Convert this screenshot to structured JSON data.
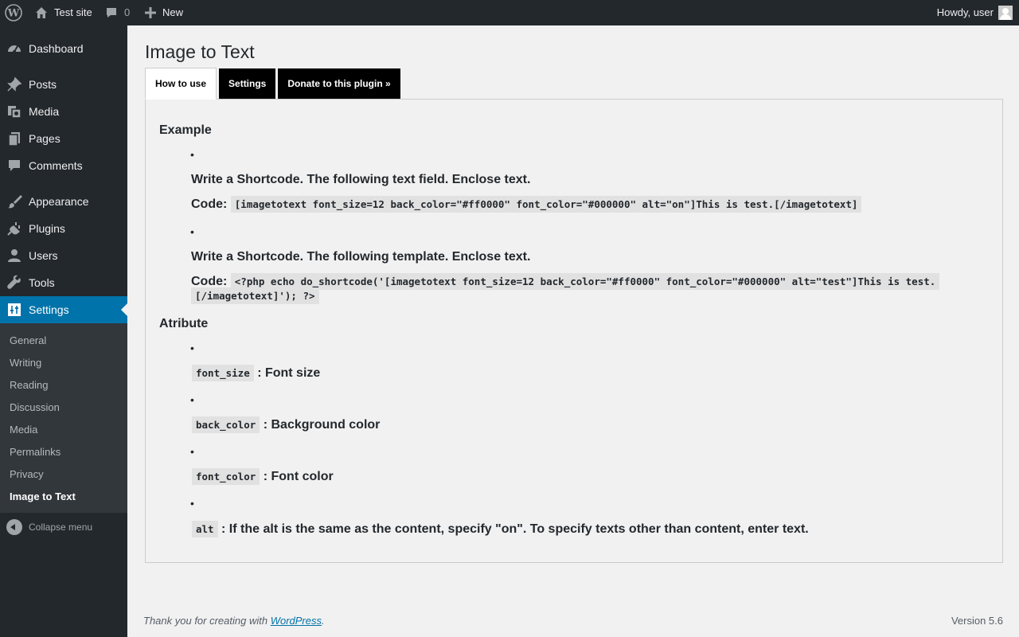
{
  "adminbar": {
    "site_name": "Test site",
    "comments_count": "0",
    "new_label": "New",
    "howdy": "Howdy, user"
  },
  "menu": {
    "items": [
      {
        "label": "Dashboard",
        "icon": "dashboard-icon"
      },
      {
        "label": "Posts",
        "icon": "pin-icon"
      },
      {
        "label": "Media",
        "icon": "media-icon"
      },
      {
        "label": "Pages",
        "icon": "pages-icon"
      },
      {
        "label": "Comments",
        "icon": "comment-icon"
      },
      {
        "label": "Appearance",
        "icon": "brush-icon"
      },
      {
        "label": "Plugins",
        "icon": "plug-icon"
      },
      {
        "label": "Users",
        "icon": "user-icon"
      },
      {
        "label": "Tools",
        "icon": "wrench-icon"
      },
      {
        "label": "Settings",
        "icon": "sliders-icon"
      }
    ],
    "submenu": [
      "General",
      "Writing",
      "Reading",
      "Discussion",
      "Media",
      "Permalinks",
      "Privacy",
      "Image to Text"
    ],
    "collapse_label": "Collapse menu"
  },
  "page": {
    "title": "Image to Text",
    "tabs": [
      "How to use",
      "Settings",
      "Donate to this plugin »"
    ]
  },
  "howto": {
    "example_heading": "Example",
    "item1_text": "Write a Shortcode. The following text field. Enclose text.",
    "code_label": "Code:",
    "item1_code": "[imagetotext font_size=12 back_color=\"#ff0000\" font_color=\"#000000\" alt=\"on\"]This is test.[/imagetotext]",
    "item2_text": "Write a Shortcode. The following template. Enclose text.",
    "item2_code": "<?php echo do_shortcode('[imagetotext font_size=12 back_color=\"#ff0000\" font_color=\"#000000\" alt=\"test\"]This is test.[/imagetotext]'); ?>",
    "attribute_heading": "Atribute",
    "attributes": [
      {
        "code": "font_size",
        "desc": ": Font size"
      },
      {
        "code": "back_color",
        "desc": ": Background color"
      },
      {
        "code": "font_color",
        "desc": ": Font color"
      },
      {
        "code": "alt",
        "desc": ": If the alt is the same as the content, specify \"on\". To specify texts other than content, enter text."
      }
    ]
  },
  "footer": {
    "thanks_prefix": "Thank you for creating with ",
    "wordpress_link": "WordPress",
    "thanks_suffix": ".",
    "version": "Version 5.6"
  }
}
